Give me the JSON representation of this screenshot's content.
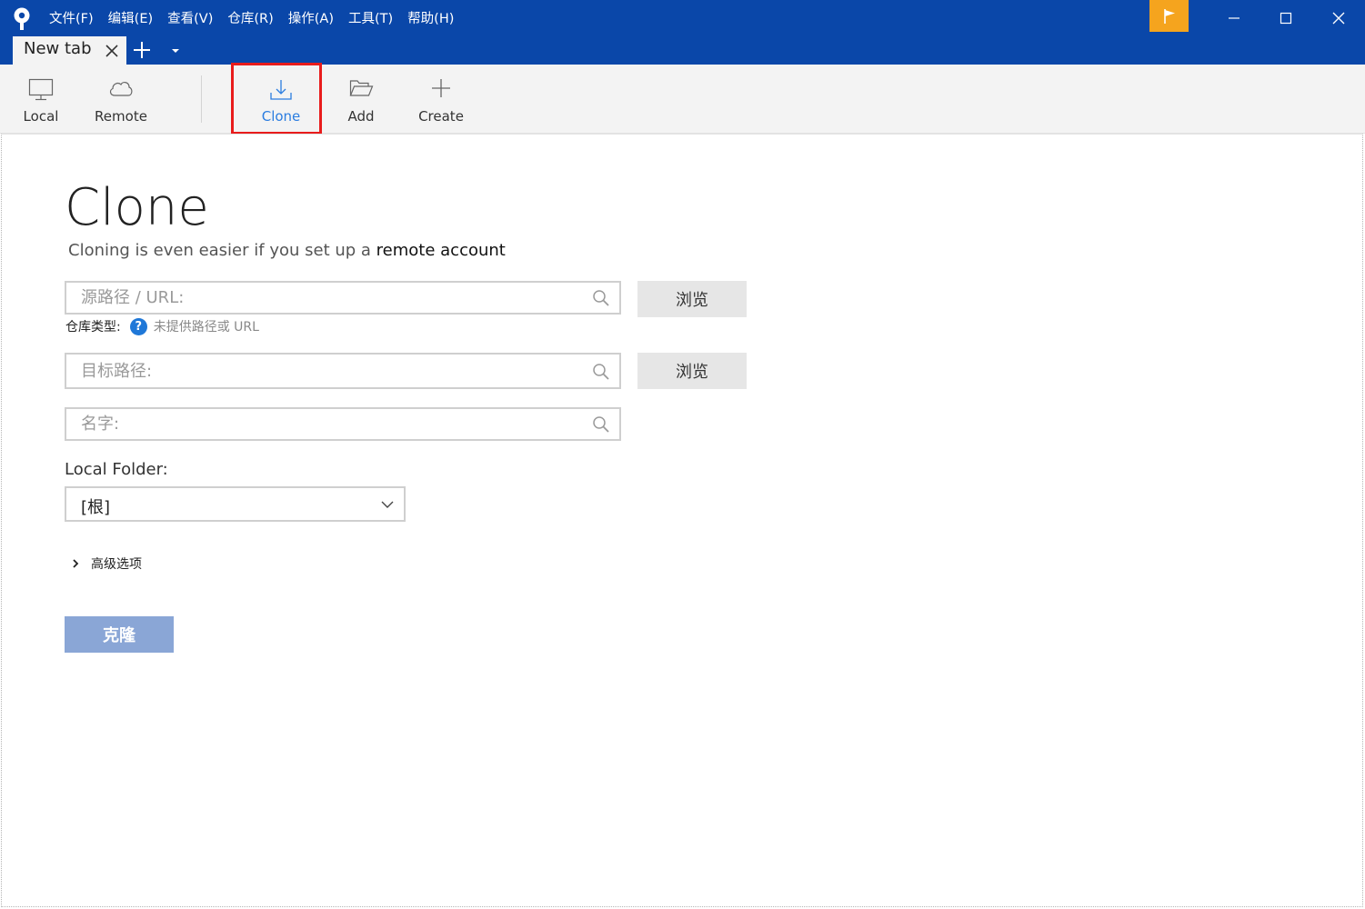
{
  "titlebar": {
    "menus": [
      "文件(F)",
      "编辑(E)",
      "查看(V)",
      "仓库(R)",
      "操作(A)",
      "工具(T)",
      "帮助(H)"
    ],
    "flag_color": "#f5a41e",
    "bar_color": "#0a47a9"
  },
  "tabs": {
    "active_label": "New tab"
  },
  "toolbar": {
    "local": "Local",
    "remote": "Remote",
    "clone": "Clone",
    "add": "Add",
    "create": "Create",
    "active": "clone"
  },
  "clone": {
    "title": "Clone",
    "subtitle_prefix": "Cloning is even easier if you set up a ",
    "subtitle_link": "remote account",
    "source_placeholder": "源路径 / URL:",
    "dest_placeholder": "目标路径:",
    "name_placeholder": "名字:",
    "browse_label": "浏览",
    "repo_type_label": "仓库类型:",
    "repo_type_value": "未提供路径或 URL",
    "local_folder_label": "Local Folder:",
    "local_folder_value": "[根]",
    "advanced_label": "高级选项",
    "clone_button": "克隆"
  }
}
